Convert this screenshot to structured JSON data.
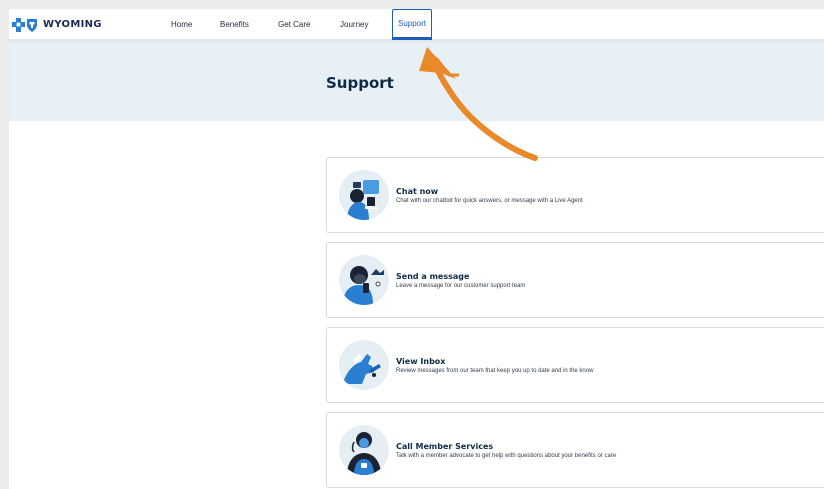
{
  "brand": {
    "name": "WYOMING"
  },
  "nav": {
    "items": [
      {
        "label": "Home"
      },
      {
        "label": "Benefits"
      },
      {
        "label": "Get Care"
      },
      {
        "label": "Journey"
      },
      {
        "label": "Support",
        "active": true
      }
    ]
  },
  "hero": {
    "title": "Support"
  },
  "cards": [
    {
      "title": "Chat now",
      "description": "Chat with our chatbot for quick answers, or message with a Live Agent",
      "icon": "chat-illustration"
    },
    {
      "title": "Send a message",
      "description": "Leave a message for our customer support team",
      "icon": "message-illustration"
    },
    {
      "title": "View Inbox",
      "description": "Review messages from our team that keep you up to date and in the know",
      "icon": "inbox-illustration"
    },
    {
      "title": "Call Member Services",
      "description": "Talk with a member advocate to get help with questions about your benefits or care",
      "icon": "phone-illustration"
    }
  ],
  "colors": {
    "accent": "#1d5fb8",
    "hero_bg": "#e7f1f5",
    "annotation_arrow": "#e8892a"
  }
}
